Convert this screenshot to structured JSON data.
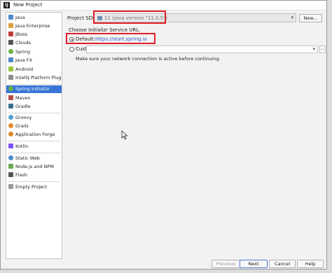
{
  "window": {
    "title": "New Project",
    "app_icon": "IJ"
  },
  "sidebar": {
    "items": [
      {
        "label": "Java",
        "icon": "folder-icon",
        "color": "#4e88c7"
      },
      {
        "label": "Java Enterprise",
        "icon": "java-ee-icon",
        "color": "#e0a23a"
      },
      {
        "label": "JBoss",
        "icon": "jboss-icon",
        "color": "#c23a3a"
      },
      {
        "label": "Clouds",
        "icon": "cloud-icon",
        "color": "#555555"
      },
      {
        "label": "Spring",
        "icon": "spring-icon",
        "color": "#6db33f"
      },
      {
        "label": "Java FX",
        "icon": "folder-icon",
        "color": "#4e88c7"
      },
      {
        "label": "Android",
        "icon": "android-icon",
        "color": "#9bc33b"
      },
      {
        "label": "IntelliJ Platform Plugin",
        "icon": "plugin-icon",
        "color": "#8a8a8a"
      },
      {
        "label": "Spring Initializr",
        "icon": "spring-initializr-icon",
        "color": "#6db33f",
        "selected": true
      },
      {
        "label": "Maven",
        "icon": "maven-icon",
        "color": "#b84a4a"
      },
      {
        "label": "Gradle",
        "icon": "gradle-icon",
        "color": "#3a6f8a"
      },
      {
        "label": "Groovy",
        "icon": "groovy-icon",
        "color": "#4ea0c9"
      },
      {
        "label": "Grails",
        "icon": "grails-icon",
        "color": "#e08a2a"
      },
      {
        "label": "Application Forge",
        "icon": "application-forge-icon",
        "color": "#e08a2a"
      },
      {
        "label": "Kotlin",
        "icon": "kotlin-icon",
        "color": "#7f52ff"
      },
      {
        "label": "Static Web",
        "icon": "web-icon",
        "color": "#4e88c7"
      },
      {
        "label": "Node.js and NPM",
        "icon": "nodejs-icon",
        "color": "#6aa84f"
      },
      {
        "label": "Flash",
        "icon": "flash-icon",
        "color": "#555555"
      },
      {
        "label": "Empty Project",
        "icon": "folder-icon",
        "color": "#9a9a9a"
      }
    ]
  },
  "main": {
    "sdk_label": "Project SDK:",
    "sdk_value": "11 (java version \"11.0.5\")",
    "new_button": "New...",
    "choose_url_label": "Choose Initializr Service URL.",
    "default_label": "Default:",
    "default_url": "https://start.spring.io",
    "custom_label": "Custom:",
    "custom_value": "",
    "network_note": "Make sure your network connection is active before continuing."
  },
  "footer": {
    "previous": "Previous",
    "next": "Next",
    "cancel": "Cancel",
    "help": "Help"
  },
  "annotations": {
    "highlight_color": "#e0202a"
  }
}
